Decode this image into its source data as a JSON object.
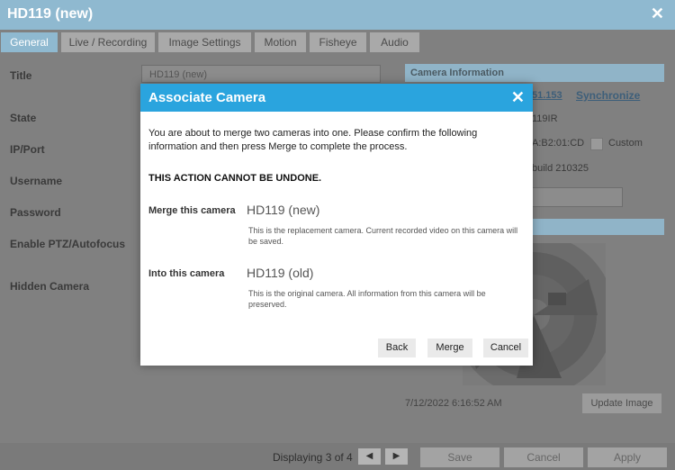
{
  "window": {
    "title": "HD119 (new)"
  },
  "tabs": [
    {
      "label": "General",
      "active": true
    },
    {
      "label": "Live / Recording"
    },
    {
      "label": "Image Settings"
    },
    {
      "label": "Motion"
    },
    {
      "label": "Fisheye"
    },
    {
      "label": "Audio"
    }
  ],
  "form": {
    "labels": {
      "title": "Title",
      "state": "State",
      "ip_port": "IP/Port",
      "username": "Username",
      "password": "Password",
      "ptz": "Enable PTZ/Autofocus",
      "hidden": "Hidden Camera"
    },
    "title_value": "HD119 (new)"
  },
  "camera_info": {
    "header": "Camera Information",
    "ip_fragment": "51.153",
    "synchronize": "Synchronize",
    "model_fragment": "119IR",
    "mac_fragment": "A:B2:01:CD",
    "custom_label": "Custom",
    "build_fragment": "build 210325"
  },
  "preview": {
    "timestamp": "7/12/2022 6:16:52 AM",
    "update_button": "Update Image"
  },
  "footer": {
    "displaying": "Displaying 3 of 4",
    "save": "Save",
    "cancel": "Cancel",
    "apply": "Apply"
  },
  "dialog": {
    "title": "Associate Camera",
    "message": "You are about to merge two cameras into one. Please confirm the following information and then press Merge to complete the process.",
    "warning": "THIS ACTION CANNOT BE UNDONE.",
    "merge_label": "Merge this camera",
    "merge_name": "HD119 (new)",
    "merge_desc": "This is the replacement camera. Current recorded video on this camera will be saved.",
    "into_label": "Into this camera",
    "into_name": "HD119 (old)",
    "into_desc": "This is the original camera. All information from this camera will be preserved.",
    "back": "Back",
    "merge": "Merge",
    "cancel": "Cancel"
  },
  "colors": {
    "accent": "#2aa4de",
    "titlebar": "#8fb9d0",
    "overlay": "#808080"
  }
}
